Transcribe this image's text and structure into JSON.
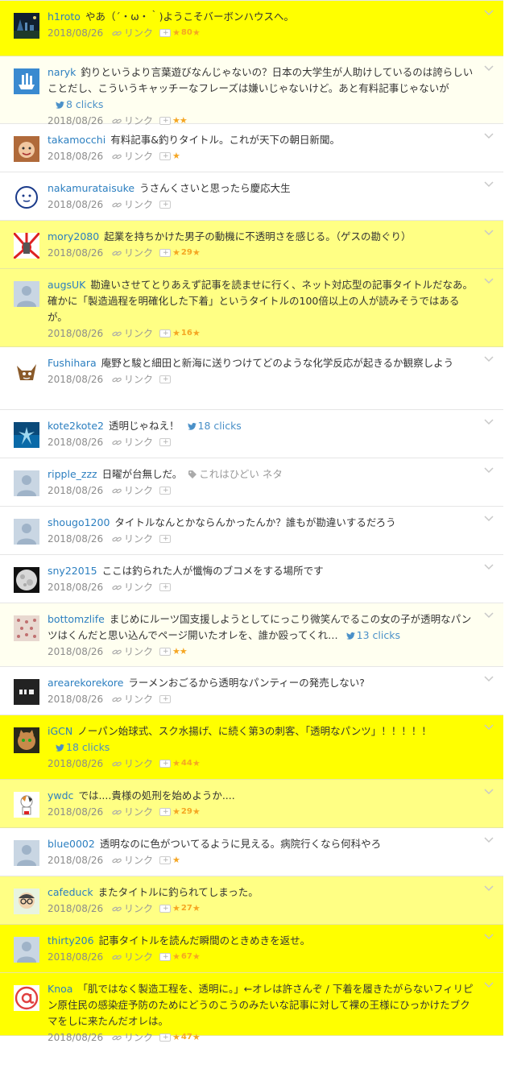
{
  "colors": {
    "highlight_strong": "#ffff00",
    "highlight_light": "#ffff84",
    "username": "#2c7fc0",
    "star": "#f5a623",
    "twitter": "#4a90c8"
  },
  "entries": [
    {
      "user": "h1roto",
      "comment": "やあ（´・ω・｀)ようこそバーボンハウスへ。",
      "date": "2018/08/26",
      "link_label": "リンク",
      "stars": 1,
      "star_count": "80",
      "trail_star": true,
      "clicks": "",
      "tag": "",
      "highlight": "strong",
      "avatar": "photo-city-night"
    },
    {
      "user": "naryk",
      "comment": "釣りというより言葉遊びなんじゃないの？日本の大学生が人助けしているのは誇らしいことだし、こういうキャッチーなフレーズは嫌いじゃないけど。あと有料記事じゃないが",
      "date": "2018/08/26",
      "link_label": "リンク",
      "stars": 2,
      "star_count": "",
      "trail_star": false,
      "clicks": "8 clicks",
      "tag": "",
      "highlight": "faint",
      "avatar": "ship-icon"
    },
    {
      "user": "takamocchi",
      "comment": "有料記事&釣りタイトル。これが天下の朝日新聞。",
      "date": "2018/08/26",
      "link_label": "リンク",
      "stars": 1,
      "star_count": "",
      "trail_star": false,
      "clicks": "",
      "tag": "",
      "highlight": "none",
      "avatar": "photo-face"
    },
    {
      "user": "nakamurataisuke",
      "comment": "うさんくさいと思ったら慶応大生",
      "date": "2018/08/26",
      "link_label": "リンク",
      "stars": 0,
      "star_count": "",
      "trail_star": false,
      "clicks": "",
      "tag": "",
      "highlight": "none",
      "avatar": "round-face"
    },
    {
      "user": "mory2080",
      "comment": "起業を持ちかけた男子の動機に不透明さを感じる。（ゲスの勘ぐり）",
      "date": "2018/08/26",
      "link_label": "リンク",
      "stars": 1,
      "star_count": "29",
      "trail_star": true,
      "clicks": "",
      "tag": "",
      "highlight": "light",
      "avatar": "rising-sun"
    },
    {
      "user": "augsUK",
      "comment": "勘違いさせてとりあえず記事を読ませに行く、ネット対応型の記事タイトルだなあ。確かに「製造過程を明確化した下着」というタイトルの100倍以上の人が読みそうではあるが。",
      "date": "2018/08/26",
      "link_label": "リンク",
      "stars": 1,
      "star_count": "16",
      "trail_star": true,
      "clicks": "",
      "tag": "",
      "highlight": "light",
      "avatar": "default"
    },
    {
      "user": "Fushihara",
      "comment": "庵野と駿と細田と新海に送りつけてどのような化学反応が起きるか観察しよう",
      "date": "2018/08/26",
      "link_label": "リンク",
      "stars": 0,
      "star_count": "",
      "trail_star": false,
      "clicks": "",
      "tag": "",
      "highlight": "none",
      "avatar": "cartoon-fox"
    },
    {
      "user": "kote2kote2",
      "comment": "透明じゃねえ！",
      "date": "2018/08/26",
      "link_label": "リンク",
      "stars": 0,
      "star_count": "",
      "trail_star": false,
      "clicks": "18 clicks",
      "tag": "",
      "highlight": "none",
      "avatar": "blue-diver"
    },
    {
      "user": "ripple_zzz",
      "comment": "日曜が台無しだ。",
      "date": "2018/08/26",
      "link_label": "リンク",
      "stars": 0,
      "star_count": "",
      "trail_star": false,
      "clicks": "",
      "tag": "これはひどい ネタ",
      "highlight": "none",
      "avatar": "default"
    },
    {
      "user": "shougo1200",
      "comment": "タイトルなんとかならんかったんか？誰もが勘違いするだろう",
      "date": "2018/08/26",
      "link_label": "リンク",
      "stars": 0,
      "star_count": "",
      "trail_star": false,
      "clicks": "",
      "tag": "",
      "highlight": "none",
      "avatar": "default"
    },
    {
      "user": "sny22015",
      "comment": "ここは釣られた人が懺悔のブコメをする場所です",
      "date": "2018/08/26",
      "link_label": "リンク",
      "stars": 0,
      "star_count": "",
      "trail_star": false,
      "clicks": "",
      "tag": "",
      "highlight": "none",
      "avatar": "moon"
    },
    {
      "user": "bottomzlife",
      "comment": "まじめにルーツ国支援しようとしてにっこり微笑んでるこの女の子が透明なパンツはくんだと思い込んでページ開いたオレを、誰か殴ってくれ…",
      "date": "2018/08/26",
      "link_label": "リンク",
      "stars": 2,
      "star_count": "",
      "trail_star": false,
      "clicks": "13 clicks",
      "tag": "",
      "highlight": "faint",
      "avatar": "pattern-dots"
    },
    {
      "user": "arearekorekore",
      "comment": "ラーメンおごるから透明なパンティーの発売しない?",
      "date": "2018/08/26",
      "link_label": "リンク",
      "stars": 0,
      "star_count": "",
      "trail_star": false,
      "clicks": "",
      "tag": "",
      "highlight": "none",
      "avatar": "dark-badge"
    },
    {
      "user": "iGCN",
      "comment": "ノーパン始球式、スク水揚げ、に続く第3の刺客、「透明なパンツ」！！！！！",
      "date": "2018/08/26",
      "link_label": "リンク",
      "stars": 1,
      "star_count": "44",
      "trail_star": true,
      "clicks": "18 clicks",
      "tag": "",
      "highlight": "strong",
      "avatar": "photo-cat"
    },
    {
      "user": "ywdc",
      "comment": "では....貴様の処刑を始めようか....",
      "date": "2018/08/26",
      "link_label": "リンク",
      "stars": 1,
      "star_count": "29",
      "trail_star": true,
      "clicks": "",
      "tag": "",
      "highlight": "light",
      "avatar": "calico-cat"
    },
    {
      "user": "blue0002",
      "comment": "透明なのに色がついてるように見える。病院行くなら何科やろ",
      "date": "2018/08/26",
      "link_label": "リンク",
      "stars": 1,
      "star_count": "",
      "trail_star": false,
      "clicks": "",
      "tag": "",
      "highlight": "none",
      "avatar": "default"
    },
    {
      "user": "cafeduck",
      "comment": "またタイトルに釣られてしまった。",
      "date": "2018/08/26",
      "link_label": "リンク",
      "stars": 1,
      "star_count": "27",
      "trail_star": true,
      "clicks": "",
      "tag": "",
      "highlight": "light",
      "avatar": "glasses-man"
    },
    {
      "user": "thirty206",
      "comment": "記事タイトルを読んだ瞬間のときめきを返せ。",
      "date": "2018/08/26",
      "link_label": "リンク",
      "stars": 1,
      "star_count": "67",
      "trail_star": true,
      "clicks": "",
      "tag": "",
      "highlight": "strong",
      "avatar": "default"
    },
    {
      "user": "Knoa",
      "comment": "「肌ではなく製造工程を、透明に。」←オレは許さんぞ / 下着を履きたがらないフィリピン原住民の感染症予防のためにどうのこうのみたいな記事に対して裸の王様にひっかけたブクマをしに来たんだオレは。",
      "date": "2018/08/26",
      "link_label": "リンク",
      "stars": 1,
      "star_count": "47",
      "trail_star": true,
      "clicks": "",
      "tag": "",
      "highlight": "strong",
      "avatar": "at-sign"
    }
  ]
}
